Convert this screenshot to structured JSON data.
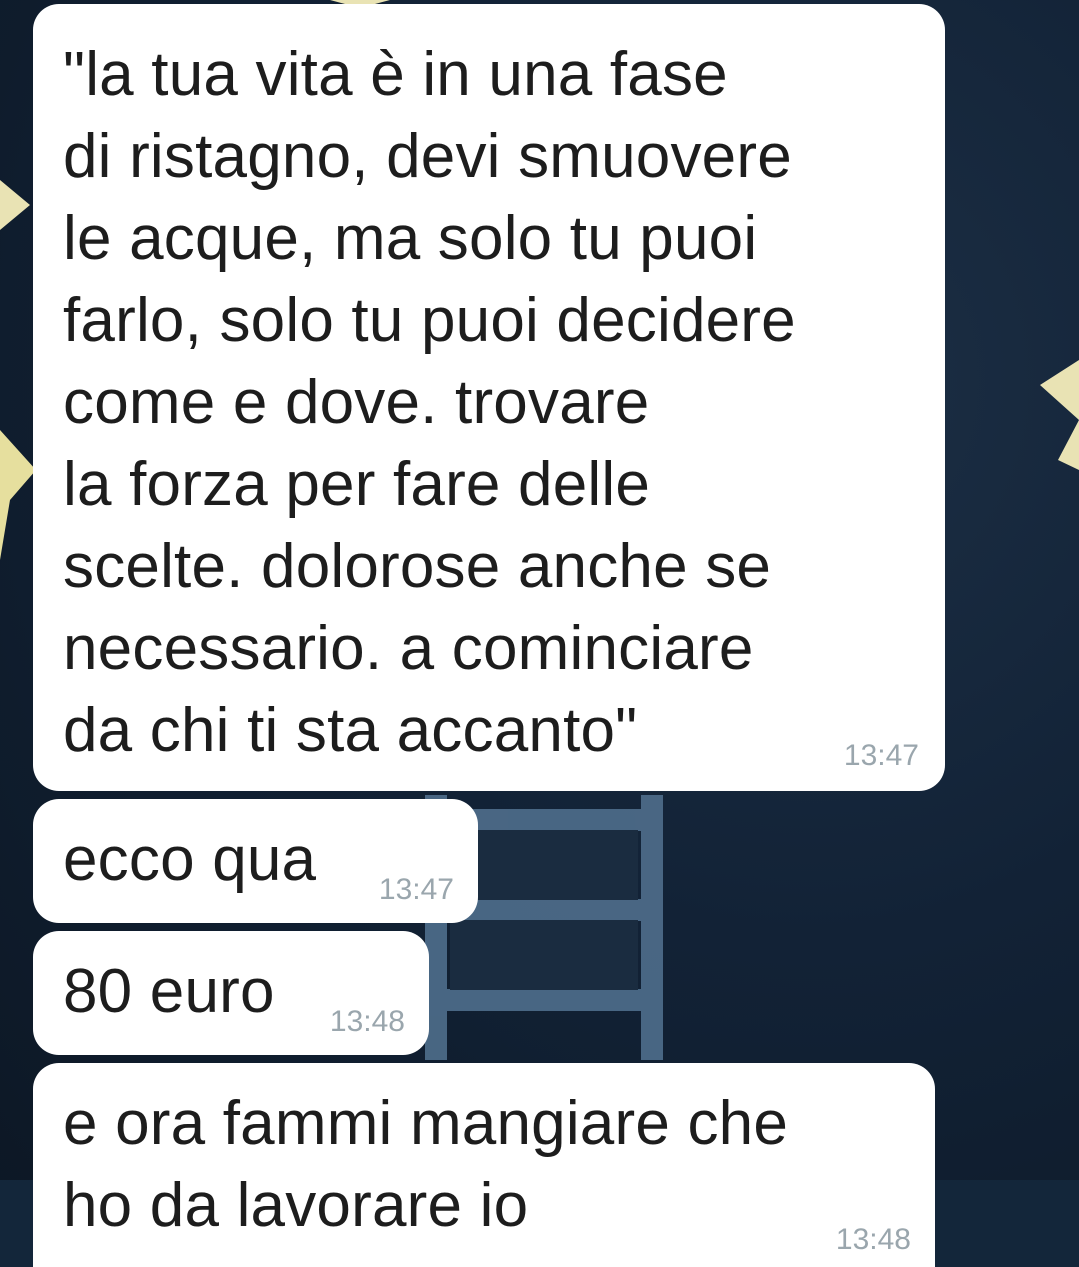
{
  "chat": {
    "messages": [
      {
        "text": "\"la tua vita è in una fase\ndi ristagno, devi smuovere\nle acque, ma solo tu puoi\nfarlo, solo tu puoi decidere\ncome e dove. trovare\nla forza per fare delle\nscelte. dolorose anche se\nnecessario. a cominciare\nda chi ti sta accanto\"",
        "time": "13:47"
      },
      {
        "text": "ecco qua",
        "time": "13:47"
      },
      {
        "text": "80 euro",
        "time": "13:48"
      },
      {
        "text": "e ora fammi mangiare che\nho da lavorare io",
        "time": "13:48"
      }
    ]
  },
  "colors": {
    "bubble": "#ffffff",
    "timestamp": "#9aa6ad",
    "background": "#0f1c2b"
  }
}
